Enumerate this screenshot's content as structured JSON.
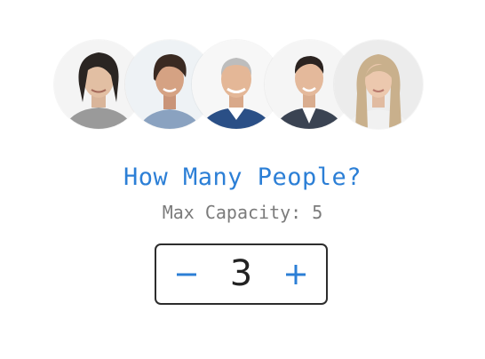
{
  "header": {
    "title": "How Many People?",
    "subtitle": "Max Capacity: 5"
  },
  "stepper": {
    "value": "3",
    "decrement_icon": "minus-icon",
    "increment_icon": "plus-icon"
  },
  "colors": {
    "accent": "#2c7fd6",
    "muted": "#7b7b7b",
    "border": "#2d2d2d"
  }
}
